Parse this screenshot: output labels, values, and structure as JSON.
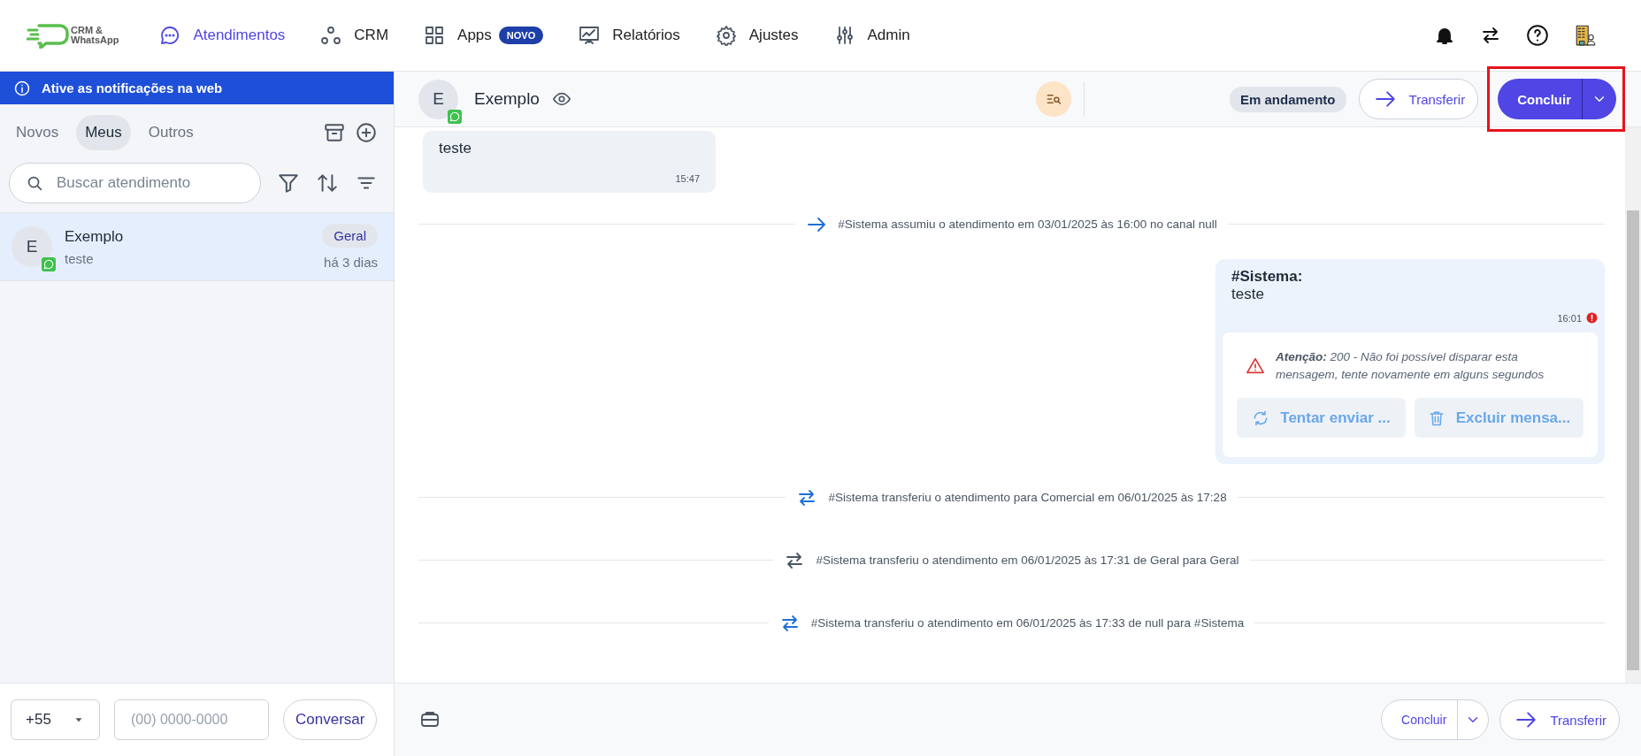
{
  "nav": {
    "logo_lines": [
      "CRM &",
      "WhatsApp"
    ],
    "items": [
      {
        "label": "Atendimentos",
        "selected": true
      },
      {
        "label": "CRM",
        "selected": false
      },
      {
        "label": "Apps",
        "selected": false,
        "badge": "NOVO"
      },
      {
        "label": "Relatórios",
        "selected": false
      },
      {
        "label": "Ajustes",
        "selected": false
      },
      {
        "label": "Admin",
        "selected": false
      }
    ]
  },
  "sidebar": {
    "banner": "Ative as notificações na web",
    "tabs": [
      {
        "label": "Novos",
        "selected": false
      },
      {
        "label": "Meus",
        "selected": true
      },
      {
        "label": "Outros",
        "selected": false
      }
    ],
    "search": {
      "placeholder": "Buscar atendimento"
    },
    "conversations": [
      {
        "avatar": "E",
        "name": "Exemplo",
        "preview": "teste",
        "tag": "Geral",
        "time": "há 3 dias",
        "selected": true
      }
    ],
    "footer": {
      "country_code": "+55",
      "phone_placeholder": "(00) 0000-0000",
      "button": "Conversar"
    }
  },
  "chat": {
    "header": {
      "avatar": "E",
      "name": "Exemplo",
      "status": "Em andamento",
      "transfer": "Transferir",
      "conclude": "Concluir"
    },
    "messages": [
      {
        "kind": "incoming",
        "text": "teste",
        "time": "15:47"
      },
      {
        "kind": "assigned",
        "text": "#Sistema assumiu o atendimento em 03/01/2025 às 16:00 no canal null"
      },
      {
        "kind": "outgoing",
        "sender": "#Sistema:",
        "text": "teste",
        "time": "16:01",
        "failed": true,
        "error": "**Atenção:** 200 - Não foi possível disparar esta mensagem, tente novamente em alguns segundos",
        "actions": [
          "Tentar enviar ...",
          "Excluir mensa..."
        ]
      },
      {
        "kind": "transferred",
        "text": "#Sistema transferiu o atendimento para Comercial em 06/01/2025 às 17:28",
        "muted": false
      },
      {
        "kind": "transferred",
        "text": "#Sistema transferiu o atendimento em 06/01/2025 às 17:31 de Geral para Geral",
        "muted": true
      },
      {
        "kind": "transferred",
        "text": "#Sistema transferiu o atendimento em 06/01/2025 às 17:33 de null para #Sistema",
        "muted": false
      }
    ],
    "footer": {
      "conclude": "Concluir",
      "transfer": "Transferir"
    }
  }
}
